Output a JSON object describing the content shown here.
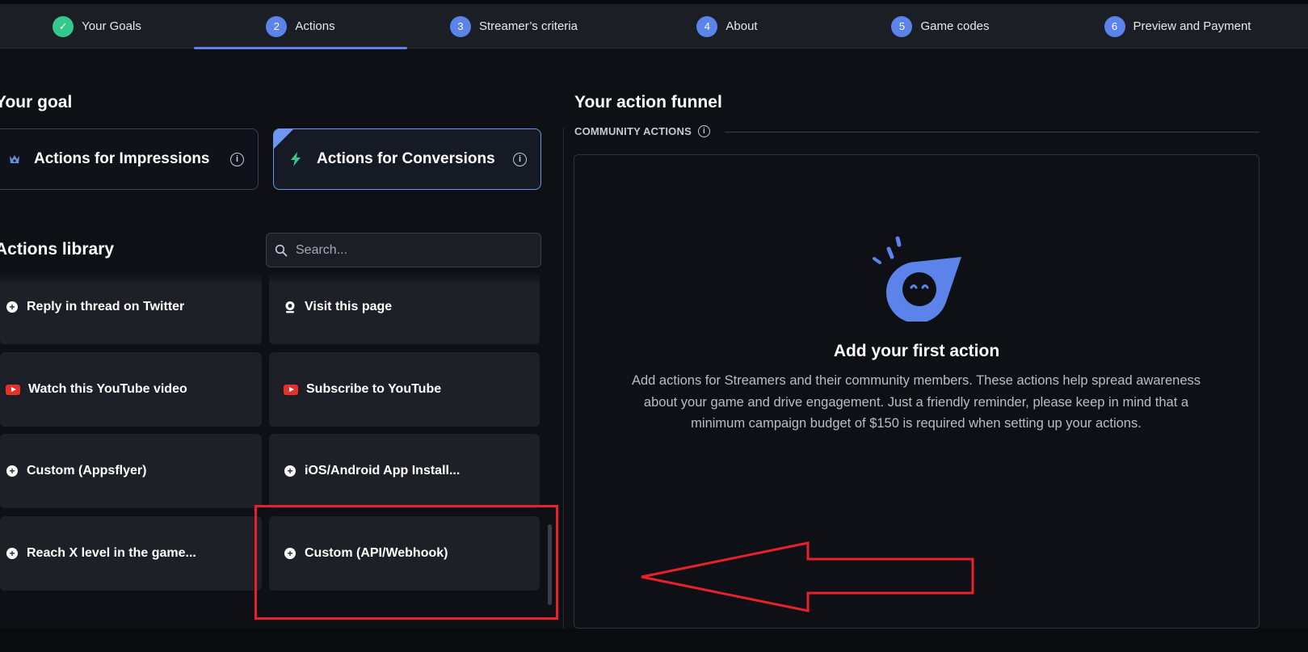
{
  "stepper": {
    "steps": [
      {
        "num": "✓",
        "label": "Your Goals"
      },
      {
        "num": "2",
        "label": "Actions"
      },
      {
        "num": "3",
        "label": "Streamer’s criteria"
      },
      {
        "num": "4",
        "label": "About"
      },
      {
        "num": "5",
        "label": "Game codes"
      },
      {
        "num": "6",
        "label": "Preview and Payment"
      }
    ],
    "active": "Actions"
  },
  "goal": {
    "heading": "Your goal",
    "options": [
      {
        "label": "Actions for Impressions",
        "icon": "crown-icon",
        "selected": false
      },
      {
        "label": "Actions for Conversions",
        "icon": "lightning-icon",
        "selected": true
      }
    ]
  },
  "library": {
    "heading": "Actions library",
    "search_placeholder": "Search...",
    "actions": [
      {
        "label": "Reply in thread on Twitter",
        "icon": "plus-circle-icon"
      },
      {
        "label": "Visit this page",
        "icon": "webcam-icon"
      },
      {
        "label": "Watch this YouTube video",
        "icon": "youtube-icon"
      },
      {
        "label": "Subscribe to YouTube",
        "icon": "youtube-icon"
      },
      {
        "label": "Custom (Appsflyer)",
        "icon": "plus-circle-icon"
      },
      {
        "label": "iOS/Android App Install...",
        "icon": "plus-circle-icon"
      },
      {
        "label": "Reach X level in the game...",
        "icon": "plus-circle-icon"
      },
      {
        "label": "Custom (API/Webhook)",
        "icon": "plus-circle-icon"
      }
    ]
  },
  "funnel": {
    "heading": "Your action funnel",
    "section_label": "COMMUNITY ACTIONS",
    "empty_title": "Add your first action",
    "empty_description": "Add actions for Streamers and their community members. These actions help spread awareness about your game and drive engagement. Just a friendly reminder, please keep in mind that a minimum campaign budget of $150 is required when setting up your actions."
  },
  "colors": {
    "background": "#0e1016",
    "accent": "#5b83ea",
    "done": "#33c98c",
    "card": "#1d2027",
    "annotation": "#e8202a"
  }
}
